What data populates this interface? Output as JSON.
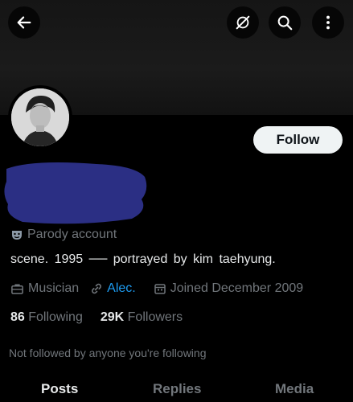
{
  "profile": {
    "bio": "scene. 1995 ── portrayed by kim taehyung.",
    "parody_label": "Parody account",
    "profession": "Musician",
    "link_text": "Alec.",
    "joined": "Joined December 2009",
    "following_count": "86",
    "following_label": "Following",
    "followers_count": "29K",
    "followers_label": "Followers",
    "not_followed_text": "Not followed by anyone you're following"
  },
  "actions": {
    "follow_label": "Follow"
  },
  "tabs": [
    {
      "label": "Posts",
      "active": true
    },
    {
      "label": "Replies",
      "active": false
    },
    {
      "label": "Media",
      "active": false
    }
  ],
  "icons": {
    "back": "back-arrow-icon",
    "grok": "grok-icon",
    "search": "search-icon",
    "more": "more-vertical-icon",
    "parody": "theater-mask-icon",
    "profession": "briefcase-icon",
    "link": "link-icon",
    "calendar": "calendar-icon"
  },
  "colors": {
    "background": "#000000",
    "text": "#e7e9ea",
    "muted": "#71767b",
    "link": "#1d9bf0",
    "follow_button": "#eff3f4",
    "redaction": "#2b2f84"
  }
}
